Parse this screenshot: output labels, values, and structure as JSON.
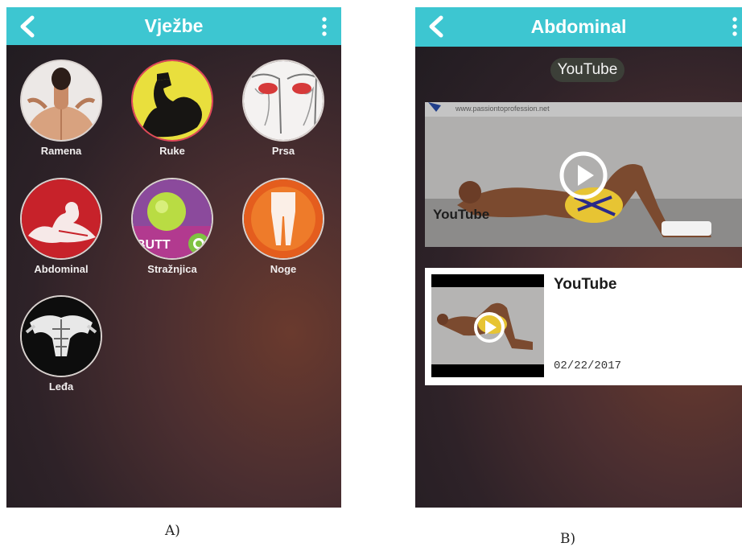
{
  "screen_a": {
    "title": "Vježbe",
    "tiles": [
      {
        "label": "Ramena",
        "icon": "shoulders-icon"
      },
      {
        "label": "Ruke",
        "icon": "biceps-icon"
      },
      {
        "label": "Prsa",
        "icon": "chest-icon"
      },
      {
        "label": "Abdominal",
        "icon": "abdominal-icon"
      },
      {
        "label": "Stražnjica",
        "icon": "butt-icon"
      },
      {
        "label": "Noge",
        "icon": "legs-icon"
      },
      {
        "label": "Leđa",
        "icon": "back-muscles-icon"
      }
    ]
  },
  "screen_b": {
    "title": "Abdominal",
    "source_pill": "YouTube",
    "featured": {
      "watermark": "www.passiontoprofession.net",
      "label": "YouTube"
    },
    "card": {
      "title": "YouTube",
      "date": "02/22/2017"
    }
  },
  "captions": {
    "a": "A)",
    "b": "B)"
  },
  "colors": {
    "appbar": "#3dc6d1",
    "background": "#2e2228",
    "accent_warm": "#6a3a2e"
  }
}
